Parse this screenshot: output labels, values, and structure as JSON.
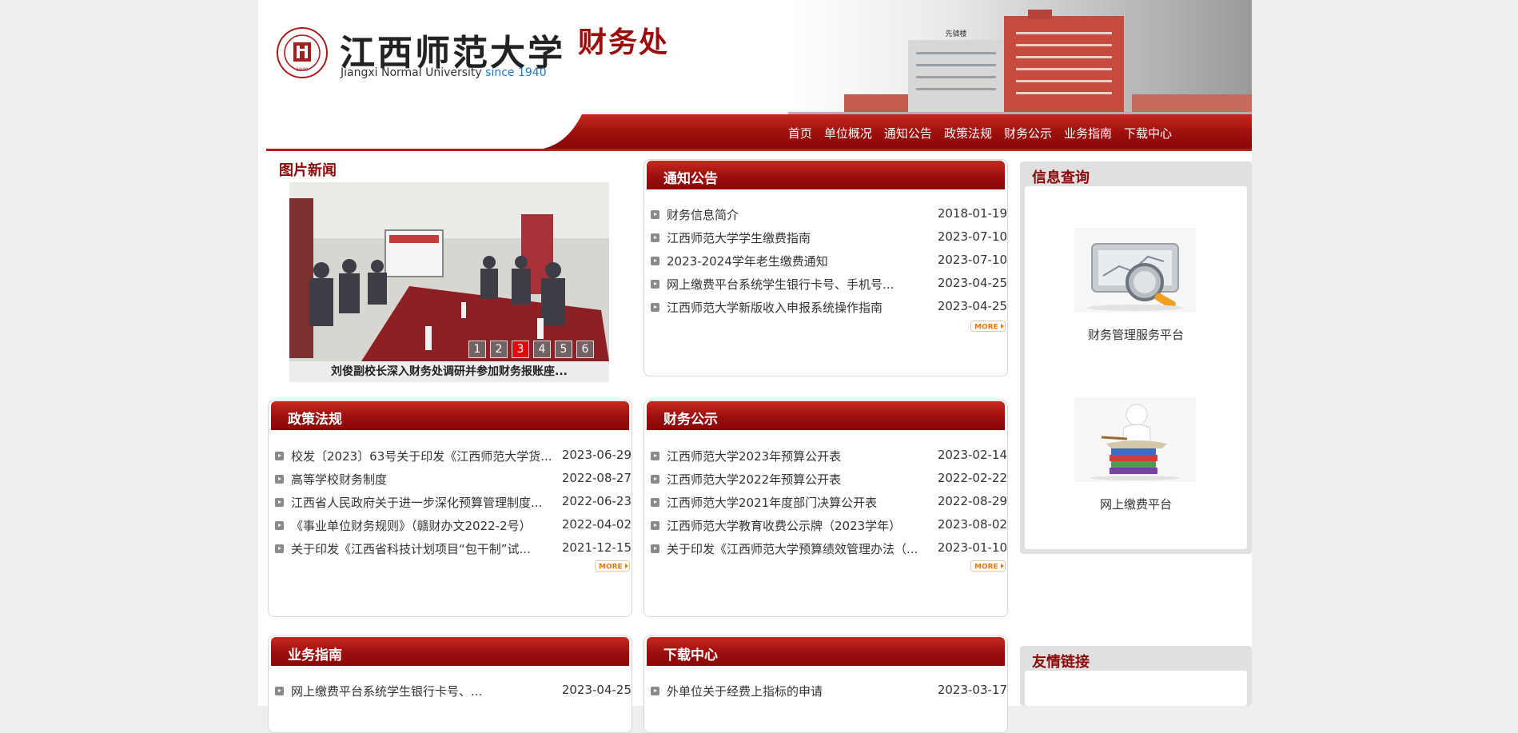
{
  "header": {
    "cn_name": "江西师范大学",
    "en_name": "Jiangxi Normal University",
    "since": "since 1940",
    "seal_year": "1940",
    "dept_name": "财务处",
    "building_sign": "先骕楼"
  },
  "nav": {
    "items": [
      "首页",
      "单位概况",
      "通知公告",
      "政策法规",
      "财务公示",
      "业务指南",
      "下载中心"
    ]
  },
  "picture_news": {
    "title": "图片新闻",
    "caption": "刘俊副校长深入财务处调研并参加财务报账座...",
    "pages": [
      "1",
      "2",
      "3",
      "4",
      "5",
      "6"
    ],
    "active_page": "3"
  },
  "notices": {
    "title": "通知公告",
    "items": [
      {
        "title": "财务信息简介",
        "date": "2018-01-19"
      },
      {
        "title": "江西师范大学学生缴费指南",
        "date": "2023-07-10"
      },
      {
        "title": "2023-2024学年老生缴费通知",
        "date": "2023-07-10"
      },
      {
        "title": "网上缴费平台系统学生银行卡号、手机号...",
        "date": "2023-04-25"
      },
      {
        "title": "江西师范大学新版收入申报系统操作指南",
        "date": "2023-04-25"
      }
    ],
    "more": "MORE"
  },
  "policies": {
    "title": "政策法规",
    "items": [
      {
        "title": "校发〔2023〕63号关于印发《江西师范大学货...",
        "date": "2023-06-29"
      },
      {
        "title": "高等学校财务制度",
        "date": "2022-08-27"
      },
      {
        "title": "江西省人民政府关于进一步深化预算管理制度...",
        "date": "2022-06-23"
      },
      {
        "title": "《事业单位财务规则》（赣财办文2022-2号）",
        "date": "2022-04-02"
      },
      {
        "title": "关于印发《江西省科技计划项目“包干制”试...",
        "date": "2021-12-15"
      }
    ],
    "more": "MORE"
  },
  "disclosure": {
    "title": "财务公示",
    "items": [
      {
        "title": "江西师范大学2023年预算公开表",
        "date": "2023-02-14"
      },
      {
        "title": "江西师范大学2022年预算公开表",
        "date": "2022-02-22"
      },
      {
        "title": "江西师范大学2021年度部门决算公开表",
        "date": "2022-08-29"
      },
      {
        "title": "江西师范大学教育收费公示牌（2023学年）",
        "date": "2023-08-02"
      },
      {
        "title": "关于印发《江西师范大学预算绩效管理办法（...",
        "date": "2023-01-10"
      }
    ],
    "more": "MORE"
  },
  "guide": {
    "title": "业务指南",
    "items": [
      {
        "title": "网上缴费平台系统学生银行卡号、...",
        "date": "2023-04-25"
      }
    ]
  },
  "downloads": {
    "title": "下载中心",
    "items": [
      {
        "title": "外单位关于经费上指标的申请",
        "date": "2023-03-17"
      }
    ]
  },
  "info_query": {
    "title": "信息查询",
    "services": [
      "财务管理服务平台",
      "网上缴费平台"
    ]
  },
  "friend_links": {
    "title": "友情链接"
  },
  "colors": {
    "brand_red": "#9b0e0e",
    "title_red": "#8a0808",
    "active_page": "#e00a0a",
    "since_blue": "#1e78c8"
  }
}
